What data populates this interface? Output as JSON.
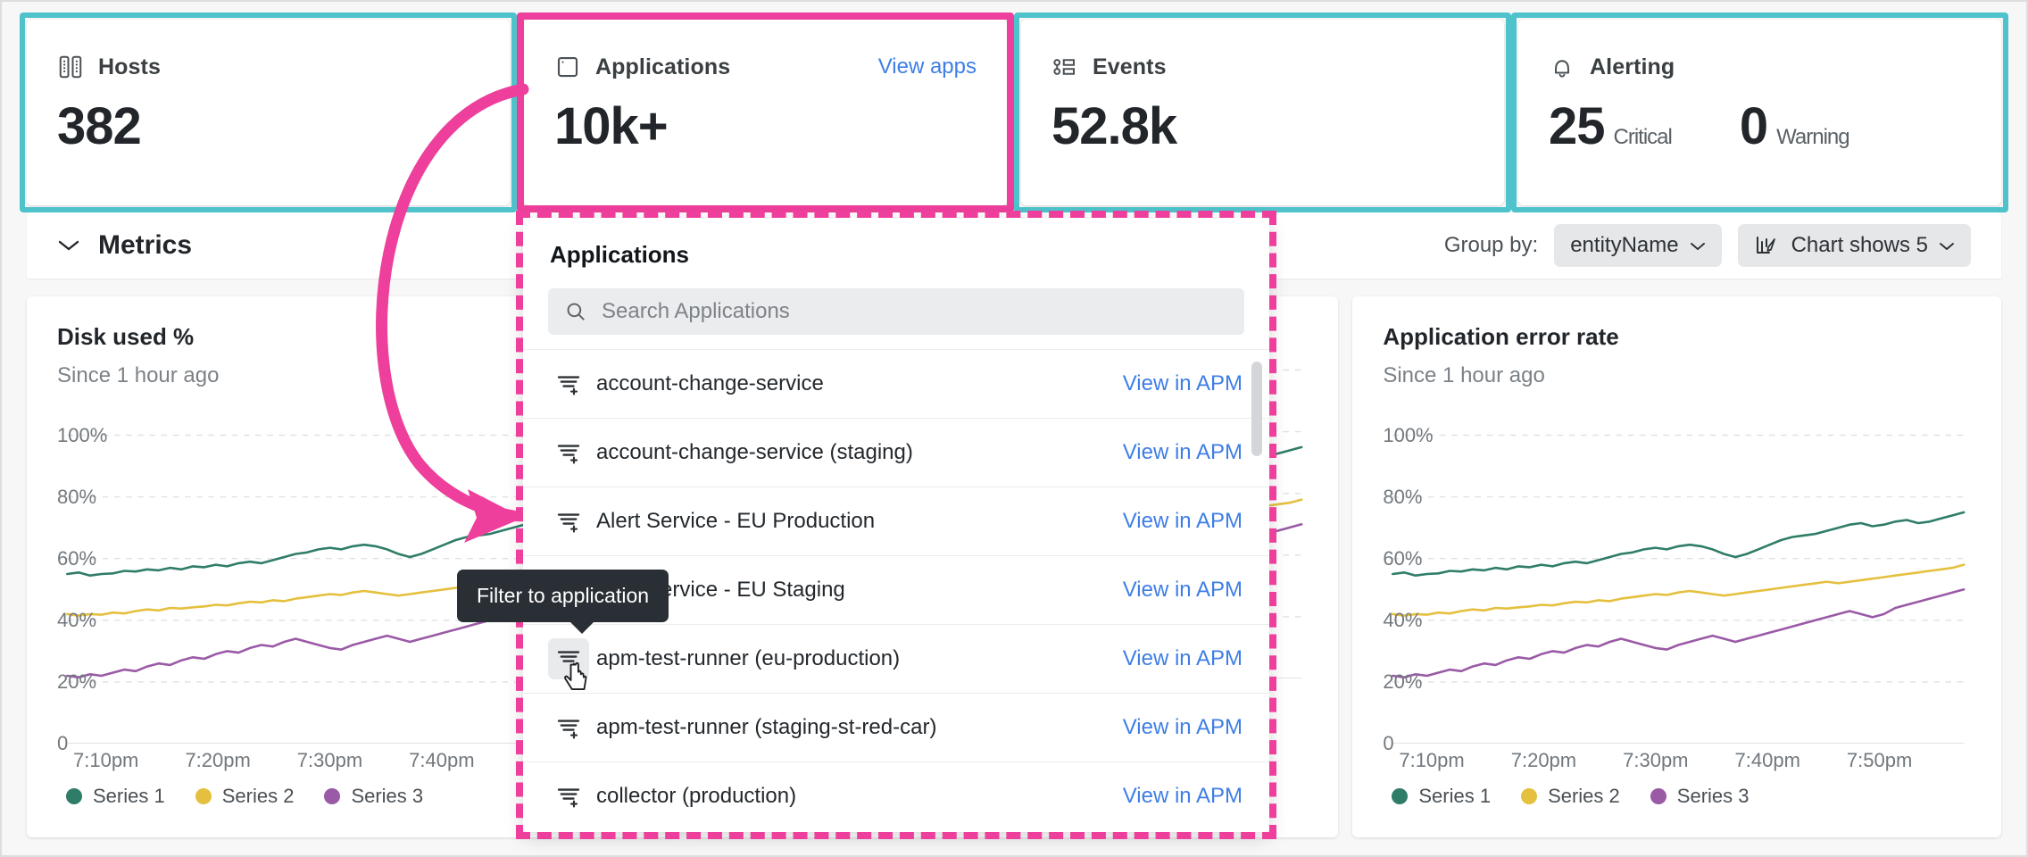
{
  "cards": [
    {
      "id": "hosts",
      "icon": "hosts-icon",
      "title": "Hosts",
      "value": "382",
      "link": "",
      "highlight": "teal"
    },
    {
      "id": "applications",
      "icon": "applications-icon",
      "title": "Applications",
      "value": "10k+",
      "link": "View apps",
      "highlight": "pink"
    },
    {
      "id": "events",
      "icon": "events-icon",
      "title": "Events",
      "value": "52.8k",
      "link": "",
      "highlight": "teal"
    }
  ],
  "alerting": {
    "icon": "bell-icon",
    "title": "Alerting",
    "highlight": "teal",
    "stats": [
      {
        "count": "25",
        "label": "Critical"
      },
      {
        "count": "0",
        "label": "Warning"
      }
    ]
  },
  "metrics_bar": {
    "collapse_icon": "chevron-down-icon",
    "title": "Metrics",
    "group_by_label": "Group by:",
    "group_by_value": "entityName",
    "chart_shows_icon": "chart-edit-icon",
    "chart_shows_value": "Chart shows 5"
  },
  "charts": [
    {
      "title": "Disk used %",
      "subtitle": "Since 1 hour ago"
    },
    {
      "title": "",
      "subtitle": ""
    },
    {
      "title": "Application error rate",
      "subtitle": "Since 1 hour ago"
    }
  ],
  "dropdown": {
    "title": "Applications",
    "search_icon": "search-icon",
    "search_placeholder": "Search Applications",
    "search_value": "",
    "row_icon": "filter-add-icon",
    "apm_link_label": "View in APM",
    "items": [
      {
        "name": "account-change-service",
        "hovered": false
      },
      {
        "name": "account-change-service (staging)",
        "hovered": false
      },
      {
        "name": "Alert Service - EU Production",
        "hovered": false
      },
      {
        "name": "Alert Service - EU Staging",
        "hovered": false
      },
      {
        "name": "apm-test-runner (eu-production)",
        "hovered": true
      },
      {
        "name": "apm-test-runner (staging-st-red-car)",
        "hovered": false
      },
      {
        "name": "collector (production)",
        "hovered": false
      }
    ]
  },
  "tooltip": {
    "text": "Filter to application"
  },
  "colors": {
    "accent_pink": "#ed3f9b",
    "accent_teal": "#4ec3cc",
    "link_blue": "#3e7ee6",
    "series1": "#2f7d68",
    "series2": "#e5c03f",
    "series3": "#9a5aa6"
  },
  "chart_data": {
    "type": "line",
    "title": "Disk used %",
    "subtitle": "Since 1 hour ago",
    "xlabel": "",
    "ylabel": "",
    "ylim": [
      0,
      110
    ],
    "yticks": [
      "0",
      "20%",
      "40%",
      "60%",
      "80%",
      "100%"
    ],
    "ytick_values": [
      0,
      20,
      40,
      60,
      80,
      100
    ],
    "xticks": [
      "7:10pm",
      "7:20pm",
      "7:30pm",
      "7:40pm",
      "7:50pm"
    ],
    "grid": true,
    "legend_position": "bottom-left",
    "series": [
      {
        "name": "Series 1",
        "color": "#2f7d68",
        "values": [
          55,
          55.5,
          54.5,
          55,
          55.2,
          56,
          55.8,
          56.5,
          56.2,
          57,
          56.5,
          57.5,
          57.2,
          58,
          57.5,
          58.5,
          59,
          58.5,
          59.5,
          60.5,
          61.5,
          62,
          63,
          63.5,
          63,
          64,
          64.5,
          64,
          63,
          61.5,
          60.5,
          61.5,
          63,
          64.5,
          66,
          67,
          67.5,
          68,
          69,
          70,
          71,
          71.5,
          70.5,
          71,
          72,
          72.5,
          71.5,
          72,
          73,
          74,
          75
        ]
      },
      {
        "name": "Series 2",
        "color": "#e5c03f",
        "values": [
          42,
          41.5,
          42,
          41.8,
          42.5,
          42.2,
          43,
          43.5,
          43.2,
          44,
          43.8,
          44.2,
          44.5,
          45,
          44.8,
          45.5,
          46,
          45.8,
          46.5,
          46.2,
          47,
          47.5,
          48,
          48.5,
          48.2,
          49,
          49.5,
          49,
          48.5,
          48,
          48.5,
          49,
          49.5,
          50,
          50.5,
          51,
          51.5,
          52,
          52.5,
          52,
          52.5,
          53,
          53.5,
          54,
          54.5,
          55,
          55.5,
          56,
          56.5,
          57,
          58
        ]
      },
      {
        "name": "Series 3",
        "color": "#9a5aa6",
        "values": [
          22,
          21.5,
          22.5,
          22,
          23,
          24,
          23.5,
          25,
          26,
          25.5,
          27,
          28,
          27.5,
          29,
          30,
          29.5,
          31,
          32,
          31.5,
          33,
          34,
          33,
          32,
          31,
          30.5,
          32,
          33,
          34,
          35,
          34,
          33,
          34,
          35,
          36,
          37,
          38,
          39,
          40,
          41,
          42,
          43,
          42,
          41,
          42,
          44,
          45,
          46,
          47,
          48,
          49,
          50
        ]
      }
    ]
  }
}
